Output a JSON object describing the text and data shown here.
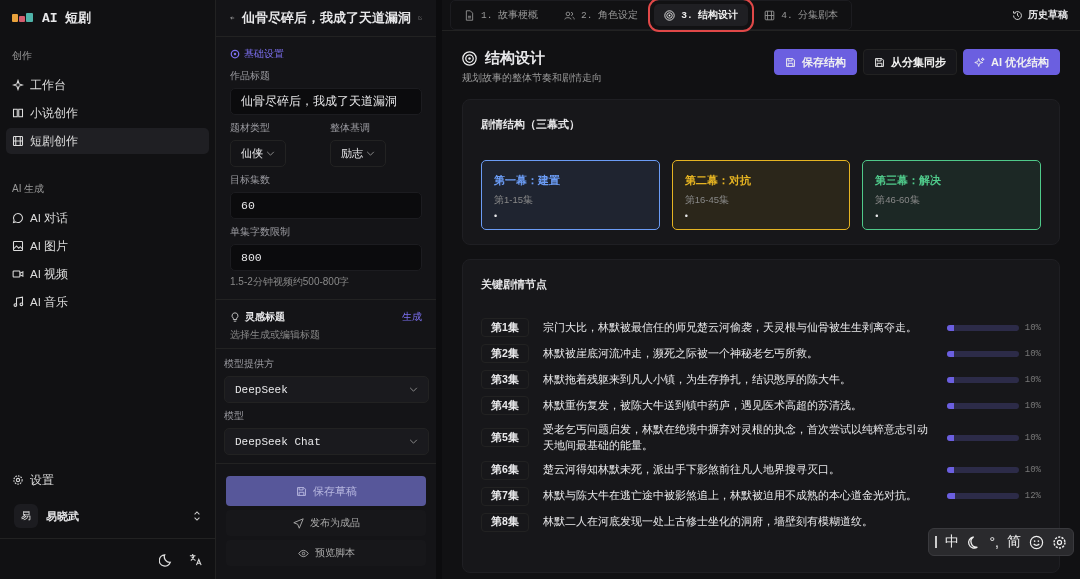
{
  "app": {
    "title": "AI 短剧"
  },
  "sidebar": {
    "sections": [
      {
        "label": "创作",
        "items": [
          {
            "label": "工作台",
            "selected": false
          },
          {
            "label": "小说创作",
            "selected": false
          },
          {
            "label": "短剧创作",
            "selected": true
          }
        ]
      },
      {
        "label": "AI 生成",
        "items": [
          {
            "label": "AI 对话",
            "selected": false
          },
          {
            "label": "AI 图片",
            "selected": false
          },
          {
            "label": "AI 视频",
            "selected": false
          },
          {
            "label": "AI 音乐",
            "selected": false
          }
        ]
      }
    ],
    "settings": "设置",
    "user": {
      "avatar": "易",
      "name": "易晓武"
    }
  },
  "editor": {
    "title": "仙骨尽碎后，我成了天道漏洞",
    "section": "基础设置",
    "title_field": {
      "label": "作品标题",
      "value": "仙骨尽碎后，我成了天道漏洞"
    },
    "genre": {
      "label": "题材类型",
      "value": "仙侠"
    },
    "tone": {
      "label": "整体基调",
      "value": "励志"
    },
    "episodes": {
      "label": "目标集数",
      "value": "60"
    },
    "word_limit": {
      "label": "单集字数限制",
      "value": "800",
      "hint": "1.5-2分钟视频约500-800字"
    },
    "inspiration": {
      "label": "灵感标题",
      "action": "生成",
      "hint": "选择生成或编辑标题"
    },
    "provider": {
      "label": "模型提供方",
      "value": "DeepSeek"
    },
    "model": {
      "label": "模型",
      "value": "DeepSeek Chat"
    },
    "buttons": [
      "保存草稿",
      "发布为成品",
      "预览脚本"
    ]
  },
  "tabs": [
    {
      "label": "1. 故事梗概",
      "selected": false,
      "highlighted": false
    },
    {
      "label": "2. 角色设定",
      "selected": false,
      "highlighted": false
    },
    {
      "label": "3. 结构设计",
      "selected": true,
      "highlighted": true
    },
    {
      "label": "4. 分集剧本",
      "selected": false,
      "highlighted": false
    }
  ],
  "history": "历史草稿",
  "page": {
    "title": "结构设计",
    "subtitle": "规划故事的整体节奏和剧情走向",
    "buttons": [
      {
        "label": "保存结构",
        "kind": "primary"
      },
      {
        "label": "从分集同步",
        "kind": "secondary"
      },
      {
        "label": "AI 优化结构",
        "kind": "ai"
      }
    ]
  },
  "acts": {
    "title": "剧情结构（三幕式）",
    "items": [
      {
        "title": "第一幕：建置",
        "range": "第1-15集",
        "bullet": "•",
        "color": "#6b9cf5"
      },
      {
        "title": "第二幕：对抗",
        "range": "第16-45集",
        "bullet": "•",
        "color": "#e6b422"
      },
      {
        "title": "第三幕：解决",
        "range": "第46-60集",
        "bullet": "•",
        "color": "#4fc98a"
      }
    ]
  },
  "plot_points": {
    "title": "关键剧情节点",
    "rows": [
      {
        "episode": "第1集",
        "text": "宗门大比，林默被最信任的师兄楚云河偷袭，天灵根与仙骨被生生剥离夺走。",
        "level": 0.1,
        "reading": "10%"
      },
      {
        "episode": "第2集",
        "text": "林默被崖底河流冲走，濒死之际被一个神秘老乞丐所救。",
        "level": 0.1,
        "reading": "10%"
      },
      {
        "episode": "第3集",
        "text": "林默拖着残躯来到凡人小镇，为生存挣扎，结识憨厚的陈大牛。",
        "level": 0.1,
        "reading": "10%"
      },
      {
        "episode": "第4集",
        "text": "林默重伤复发，被陈大牛送到镇中药庐，遇见医术高超的苏清浅。",
        "level": 0.1,
        "reading": "10%"
      },
      {
        "episode": "第5集",
        "text": "受老乞丐问题启发，林默在绝境中摒弃对灵根的执念，首次尝试以纯粹意志引动天地间最基础的能量。",
        "level": 0.1,
        "reading": "10%"
      },
      {
        "episode": "第6集",
        "text": "楚云河得知林默未死，派出手下影煞前往凡人地界搜寻灭口。",
        "level": 0.1,
        "reading": "10%"
      },
      {
        "episode": "第7集",
        "text": "林默与陈大牛在逃亡途中被影煞追上，林默被迫用不成熟的本心道金光对抗。",
        "level": 0.12,
        "reading": "12%"
      },
      {
        "episode": "第8集",
        "text": "林默二人在河底发现一处上古修士坐化的洞府，墙壁刻有模糊道纹。"
      }
    ]
  },
  "ime": {
    "items": [
      "中",
      "°,",
      "简"
    ]
  }
}
